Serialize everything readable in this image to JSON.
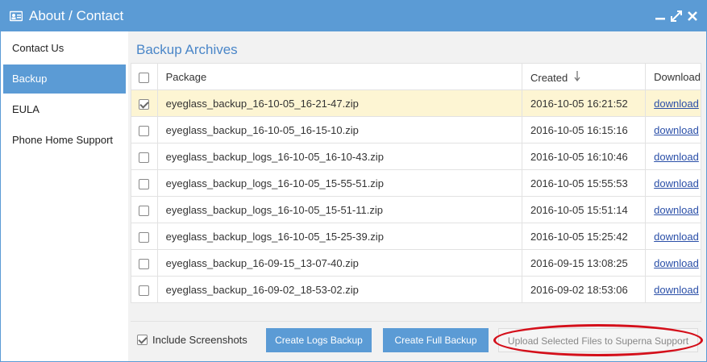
{
  "window": {
    "title": "About / Contact",
    "icons": [
      "contact-card-icon",
      "minimize-icon",
      "maximize-icon",
      "close-icon"
    ],
    "accent_color": "#5b9bd5"
  },
  "sidebar": {
    "items": [
      {
        "label": "Contact Us",
        "active": false
      },
      {
        "label": "Backup",
        "active": true
      },
      {
        "label": "EULA",
        "active": false
      },
      {
        "label": "Phone Home Support",
        "active": false
      }
    ]
  },
  "main": {
    "title": "Backup Archives",
    "table": {
      "headers": {
        "package": "Package",
        "created": "Created",
        "download": "Download"
      },
      "sort": {
        "column": "created",
        "direction": "descending",
        "icon": "sort-down-arrow-icon"
      },
      "rows": [
        {
          "package": "eyeglass_backup_16-10-05_16-21-47.zip",
          "created": "2016-10-05 16:21:52",
          "download": "download",
          "checked": true
        },
        {
          "package": "eyeglass_backup_16-10-05_16-15-10.zip",
          "created": "2016-10-05 16:15:16",
          "download": "download",
          "checked": false
        },
        {
          "package": "eyeglass_backup_logs_16-10-05_16-10-43.zip",
          "created": "2016-10-05 16:10:46",
          "download": "download",
          "checked": false
        },
        {
          "package": "eyeglass_backup_logs_16-10-05_15-55-51.zip",
          "created": "2016-10-05 15:55:53",
          "download": "download",
          "checked": false
        },
        {
          "package": "eyeglass_backup_logs_16-10-05_15-51-11.zip",
          "created": "2016-10-05 15:51:14",
          "download": "download",
          "checked": false
        },
        {
          "package": "eyeglass_backup_logs_16-10-05_15-25-39.zip",
          "created": "2016-10-05 15:25:42",
          "download": "download",
          "checked": false
        },
        {
          "package": "eyeglass_backup_16-09-15_13-07-40.zip",
          "created": "2016-09-15 13:08:25",
          "download": "download",
          "checked": false
        },
        {
          "package": "eyeglass_backup_16-09-02_18-53-02.zip",
          "created": "2016-09-02 18:53:06",
          "download": "download",
          "checked": false
        }
      ]
    },
    "footer": {
      "include_screenshots_label": "Include Screenshots",
      "include_screenshots_checked": true,
      "create_logs_label": "Create Logs Backup",
      "create_full_label": "Create Full Backup",
      "upload_label": "Upload Selected Files to Superna Support",
      "annotation_color": "#d40f1a"
    }
  }
}
